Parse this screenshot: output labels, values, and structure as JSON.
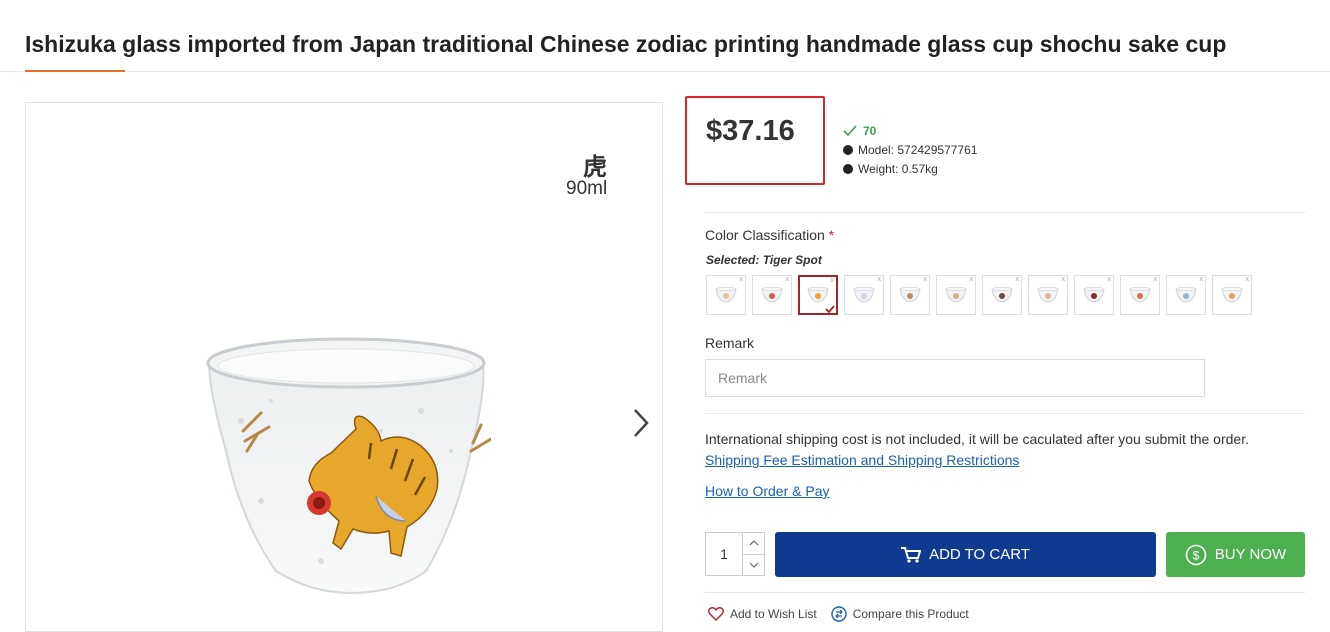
{
  "product": {
    "title": "Ishizuka glass imported from Japan traditional Chinese zodiac printing handmade glass cup shochu sake cup",
    "price": "$37.16",
    "sold_count": "70",
    "model": "Model: 572429577761",
    "weight": "Weight: 0.57kg"
  },
  "gallery": {
    "zodiac_char": "虎",
    "volume": "90ml",
    "image_icon": "tiger-sake-cup",
    "next_icon": "chevron-right-icon"
  },
  "options": {
    "color_label": "Color Classification",
    "required_mark": "*",
    "selected_prefix": "Selected:",
    "selected_value": "Tiger Spot",
    "swatch_count": 12,
    "active_swatch": 3
  },
  "remark": {
    "label": "Remark",
    "placeholder": "Remark",
    "value": ""
  },
  "shipping": {
    "note": "International shipping cost is not included, it will be caculated after you submit the order.",
    "estimate_link": "Shipping Fee Estimation and Shipping Restrictions",
    "how_to_link": "How to Order & Pay"
  },
  "purchase": {
    "quantity": "1",
    "add_to_cart": "ADD TO CART",
    "buy_now": "BUY NOW"
  },
  "actions": {
    "wishlist": "Add to Wish List",
    "compare": "Compare this Product"
  },
  "colors": {
    "accent": "#e8702a",
    "price_border": "#d9242b",
    "cart_button": "#103a8f",
    "buy_button": "#4caf50",
    "link": "#1a5fb4",
    "sold_green": "#3aa04a"
  }
}
